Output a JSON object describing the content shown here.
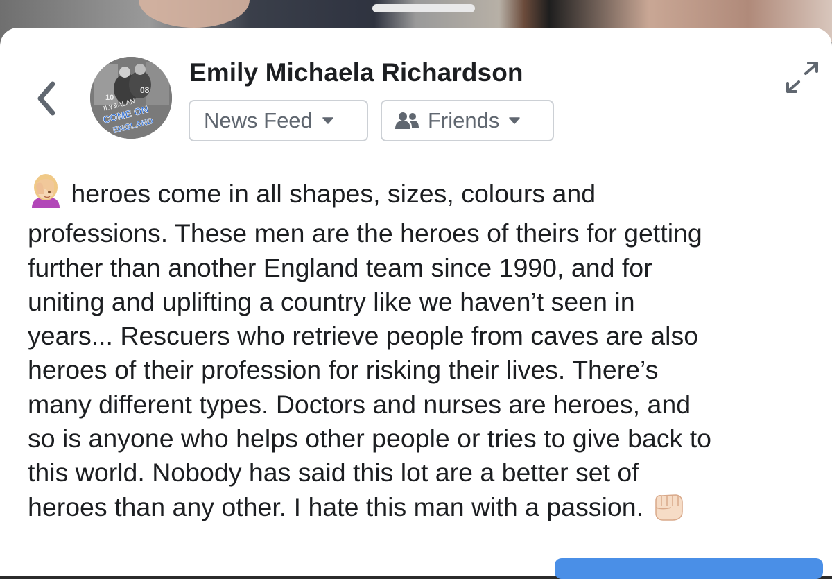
{
  "profile": {
    "name": "Emily Michaela Richardson",
    "avatar_text_lines": [
      "08",
      "10",
      "ILY&ALAN",
      "COME ON",
      "ENGLAND"
    ]
  },
  "header": {
    "back_icon": "chevron-left-icon",
    "expand_icon": "expand-arrows-icon"
  },
  "audience": {
    "feed_label": "News Feed",
    "privacy_label": "Friends",
    "privacy_icon": "friends-icon",
    "caret_icon": "caret-down-icon"
  },
  "post": {
    "lead_emoji": "face-palm-emoji",
    "trailing_emoji": "fist-bump-emoji",
    "lines": [
      " heroes come in all shapes, sizes, colours and",
      "professions. These men are the heroes of theirs for getting",
      "further than another England team since 1990, and for",
      "uniting and uplifting a country like we haven’t seen in",
      "years... Rescuers who retrieve people from caves are also",
      "heroes of their profession for risking their lives. There’s",
      "many different types. Doctors and nurses are heroes, and",
      "so is anyone who helps other people or tries to give back to",
      "this world. Nobody has said this lot are a better set of",
      "heroes than any other. I hate this man with a passion. "
    ]
  },
  "colors": {
    "text": "#1c1e21",
    "secondary": "#606770",
    "border": "#ccd0d5",
    "accent": "#4a8fe7"
  }
}
